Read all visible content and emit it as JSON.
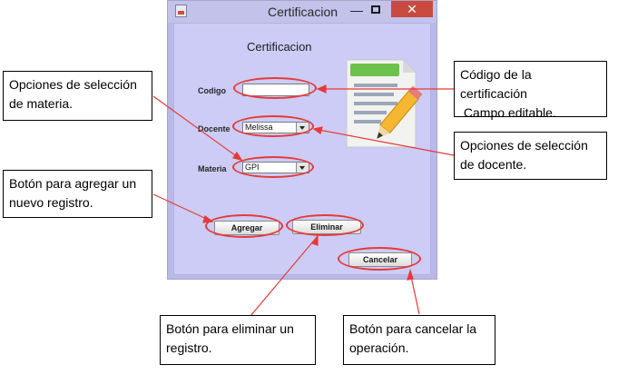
{
  "window": {
    "title": "Certificacion",
    "minimize_glyph": "—",
    "close_glyph": "✕"
  },
  "form": {
    "heading": "Certificacion",
    "codigo_label": "Codigo",
    "codigo_value": "",
    "docente_label": "Docente",
    "docente_value": "Melissa",
    "materia_label": "Materia",
    "materia_value": "GPI",
    "agregar_label": "Agregar",
    "eliminar_label": "Eliminar",
    "cancelar_label": "Cancelar"
  },
  "icons": {
    "app": "java-cup-icon",
    "certificate": "certificate-pencil-icon"
  },
  "callouts": {
    "materia": [
      "Opciones de selección",
      "de materia."
    ],
    "codigo": [
      "Código de la",
      "certificación",
      " Campo editable."
    ],
    "agregar": [
      "Botón para agregar un",
      "nuevo registro."
    ],
    "docente": [
      "Opciones de selección",
      "de docente."
    ],
    "eliminar": [
      "Botón para eliminar un",
      "registro."
    ],
    "cancelar": [
      "Botón para cancelar la",
      "operación."
    ]
  },
  "colors": {
    "highlight": "#e53a3a",
    "window_bg": "#ccccf7",
    "close_button": "#c94a3f"
  }
}
